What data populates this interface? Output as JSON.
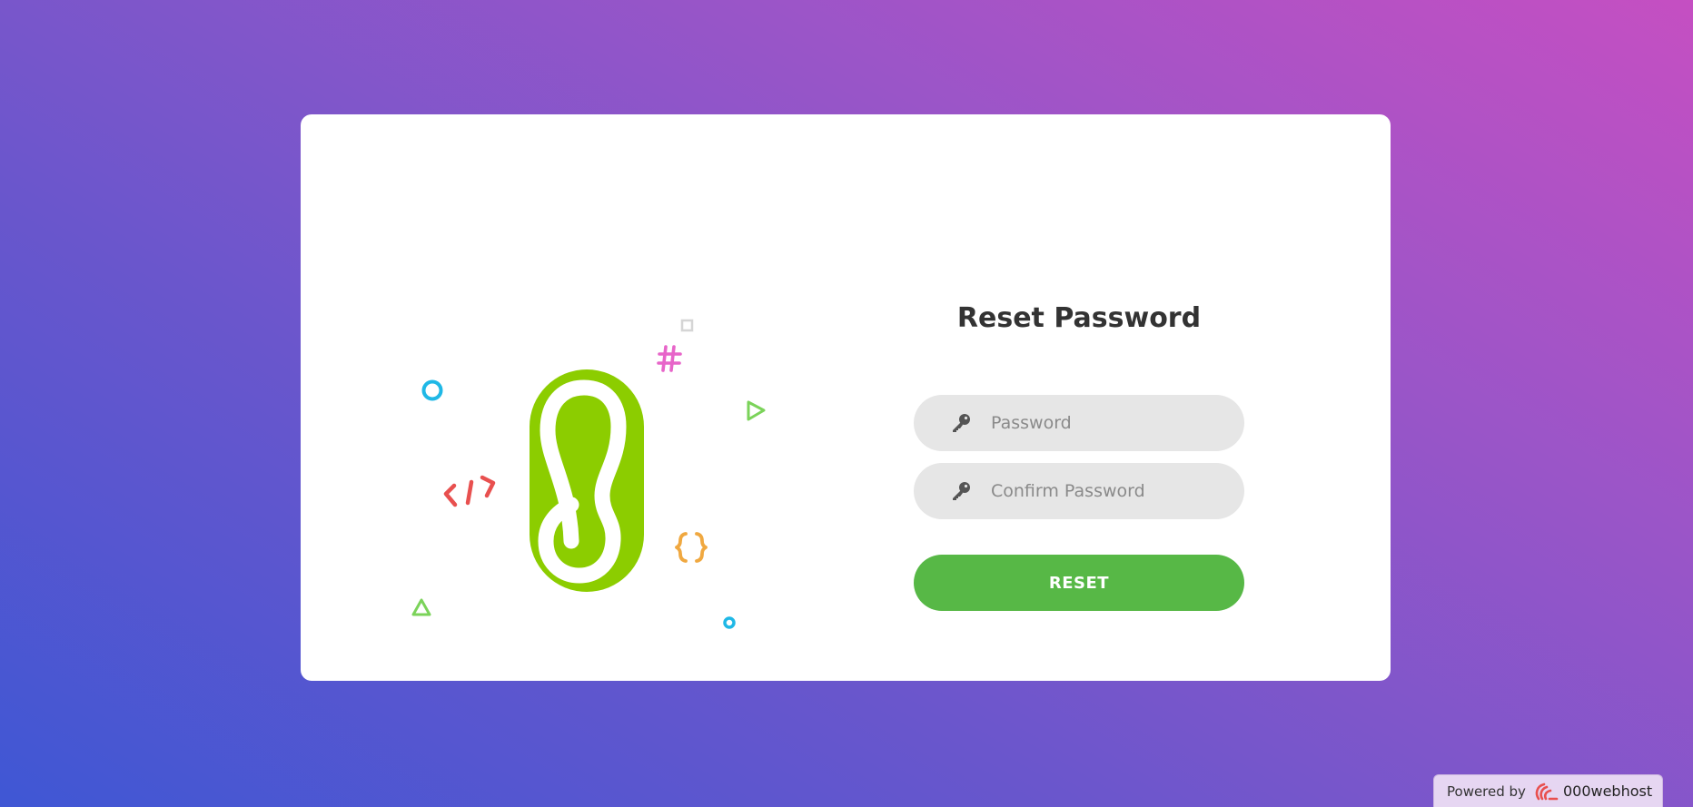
{
  "form": {
    "title": "Reset Password",
    "password_placeholder": "Password",
    "confirm_placeholder": "Confirm Password",
    "reset_label": "RESET"
  },
  "footer": {
    "powered_by": "Powered by",
    "brand": "000webhost"
  },
  "icons": {
    "field_icon": "key-icon",
    "logo": "000webhost-logo",
    "decorations": [
      "circle-icon",
      "code-tag-icon",
      "hash-icon",
      "square-icon",
      "play-triangle-icon",
      "curly-braces-icon",
      "triangle-icon",
      "small-circle-icon"
    ]
  },
  "colors": {
    "accent_green": "#57b846",
    "logo_green": "#8ccd00",
    "field_bg": "#e6e6e6",
    "title_text": "#333333",
    "cyan": "#1fb8e6",
    "pink": "#e765c9",
    "red": "#e8504f",
    "orange": "#f0a840"
  }
}
